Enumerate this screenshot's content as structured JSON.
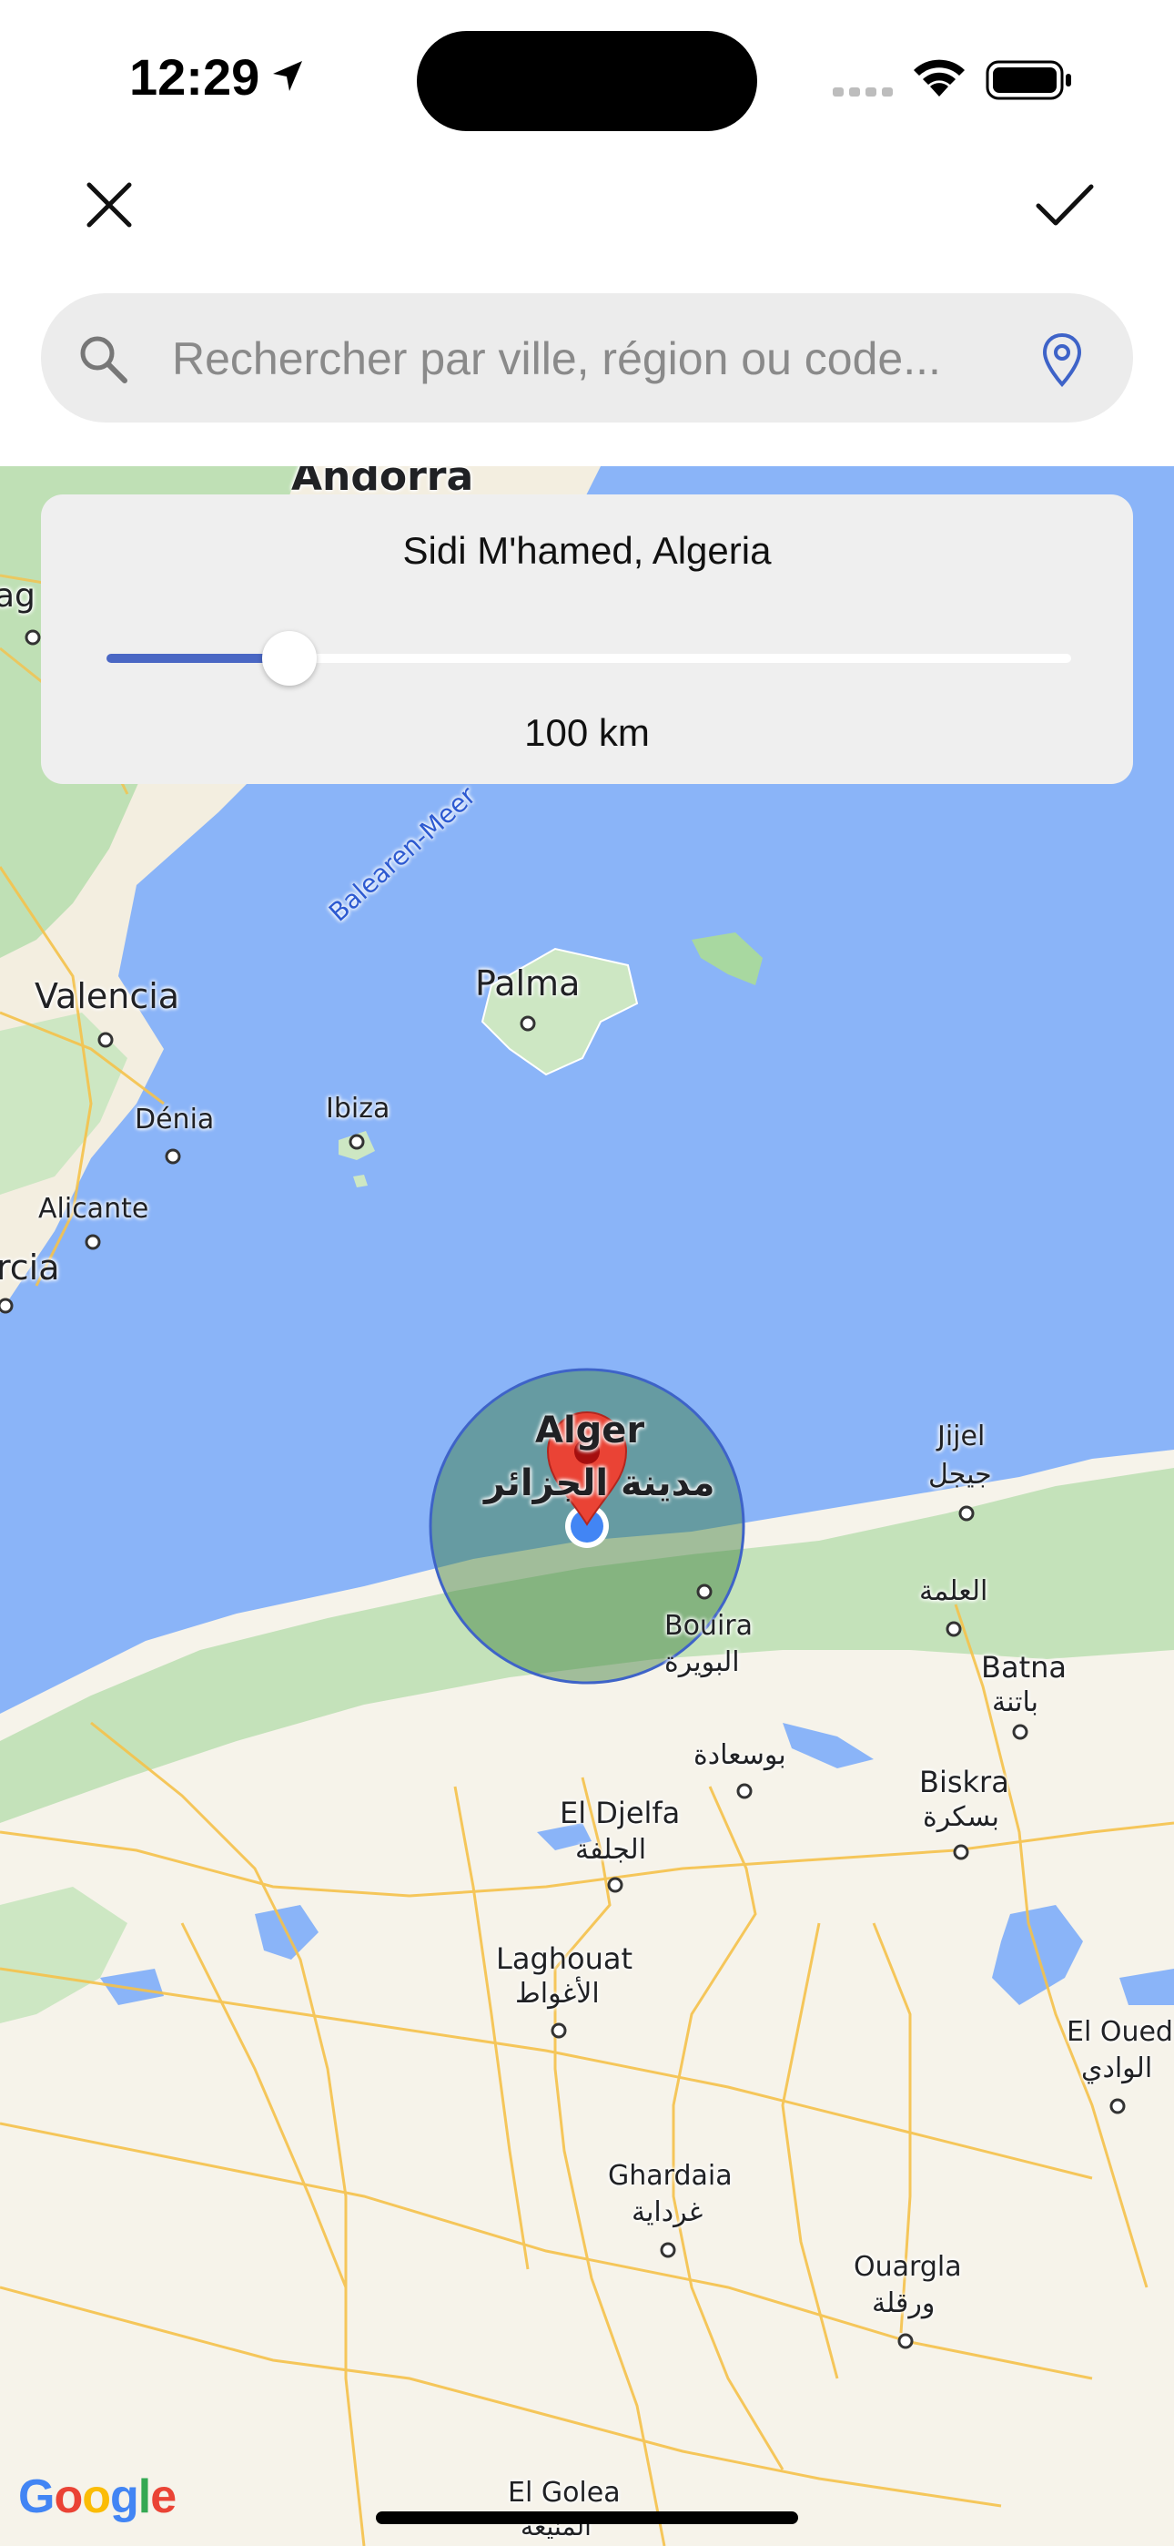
{
  "status_bar": {
    "time": "12:29"
  },
  "top_bar": {
    "close_icon": "close-icon",
    "confirm_icon": "checkmark-icon"
  },
  "search": {
    "placeholder": "Rechercher par ville, région ou code...",
    "value": ""
  },
  "radius_panel": {
    "location": "Sidi M'hamed, Algeria",
    "distance_label": "100 km",
    "slider_fraction": 0.19
  },
  "map": {
    "labels": {
      "andorra": "Andorra",
      "valencia": "Valencia",
      "denia": "Dénia",
      "alicante": "Alicante",
      "ibiza": "Ibiza",
      "palma": "Palma",
      "balearen": "Balearen-Meer",
      "alger": "Alger",
      "alger_ar": "مدينة الجزائر",
      "jijel": "Jijel",
      "jijel_ar": "جيجل",
      "elma": "العلمة",
      "bouira": "Bouira",
      "bouira_ar": "البويرة",
      "batna": "Batna",
      "batna_ar": "باتنة",
      "bousaada_ar": "بوسعادة",
      "biskra": "Biskra",
      "biskra_ar": "بسكرة",
      "djelfa": "El Djelfa",
      "djelfa_ar": "الجلفة",
      "laghouat": "Laghouat",
      "laghouat_ar": "الأغواط",
      "eloued": "El Oued",
      "eloued_ar": "الوادي",
      "ghardaia": "Ghardaia",
      "ghardaia_ar": "غرداية",
      "ouargla": "Ouargla",
      "ouargla_ar": "ورقلة",
      "elgolea": "El Golea",
      "elgolea_ar": "المنيعة",
      "partial_ag": "ag",
      "partial_rcia": "rcia"
    },
    "attribution": "Google"
  }
}
